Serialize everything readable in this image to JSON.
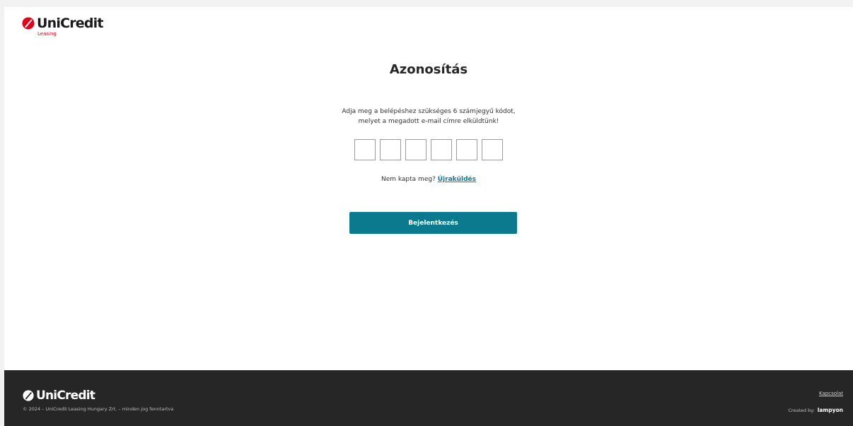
{
  "header": {
    "logo_text": "UniCredit",
    "logo_sub": "Leasing"
  },
  "auth": {
    "title": "Azonosítás",
    "instruction_line1": "Adja meg a belépéshez szükséges 6 számjegyű kódot,",
    "instruction_line2": "melyet a megadott e-mail címre elküldtünk!",
    "code_digits": [
      "",
      "",
      "",
      "",
      "",
      ""
    ],
    "resend_prompt": "Nem kapta meg?",
    "resend_link": "Újraküldés",
    "login_button": "Bejelentkezés"
  },
  "footer": {
    "logo_text": "UniCredit",
    "copyright": "© 2024 – UniCredit Leasing Hungary Zrt. – minden jog fenntartva",
    "contact_link": "Kapcsolat",
    "created_by_label": "Created by:",
    "created_by_brand": "lampyon"
  },
  "colors": {
    "brand_red": "#e2001a",
    "button_teal": "#0b7a8f",
    "link_teal": "#0b7a96",
    "footer_bg": "#262626"
  },
  "icons": {
    "logo_mark": "unicredit-one-icon"
  }
}
